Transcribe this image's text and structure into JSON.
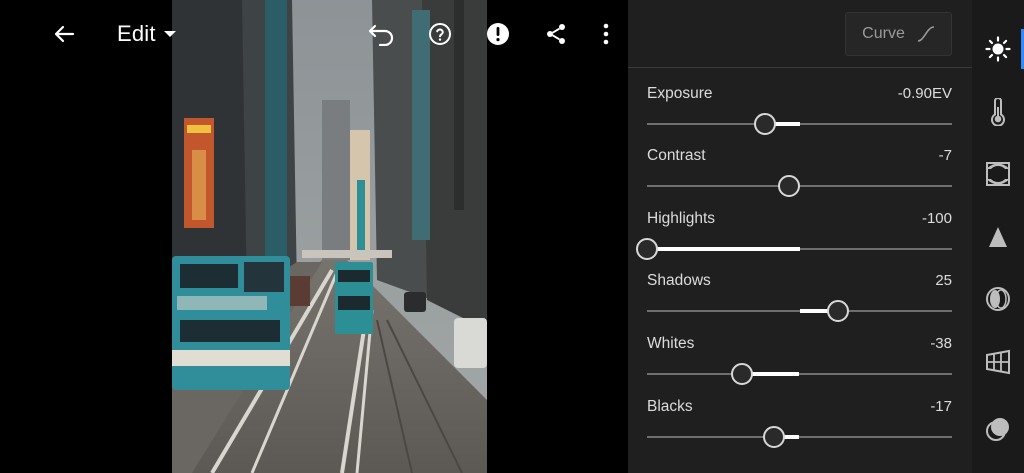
{
  "header": {
    "edit_label": "Edit"
  },
  "panel": {
    "curve_label": "Curve",
    "sliders": [
      {
        "id": "exposure",
        "label": "Exposure",
        "value_text": "-0.90EV",
        "value": -0.9,
        "min": -4,
        "max": 4
      },
      {
        "id": "contrast",
        "label": "Contrast",
        "value_text": "-7",
        "value": -7,
        "min": -100,
        "max": 100
      },
      {
        "id": "highlights",
        "label": "Highlights",
        "value_text": "-100",
        "value": -100,
        "min": -100,
        "max": 100
      },
      {
        "id": "shadows",
        "label": "Shadows",
        "value_text": "25",
        "value": 25,
        "min": -100,
        "max": 100
      },
      {
        "id": "whites",
        "label": "Whites",
        "value_text": "-38",
        "value": -38,
        "min": -100,
        "max": 100
      },
      {
        "id": "blacks",
        "label": "Blacks",
        "value_text": "-17",
        "value": -17,
        "min": -100,
        "max": 100
      }
    ]
  },
  "rail": {
    "items": [
      {
        "icon": "light-icon",
        "active": true
      },
      {
        "icon": "color-temperature-icon",
        "active": false
      },
      {
        "icon": "effects-vignette-icon",
        "active": false
      },
      {
        "icon": "detail-icon",
        "active": false
      },
      {
        "icon": "optics-icon",
        "active": false
      },
      {
        "icon": "geometry-icon",
        "active": false
      },
      {
        "icon": "presets-icon",
        "active": false
      }
    ]
  },
  "colors": {
    "panel_bg": "#1f1f1f",
    "rail_bg": "#1a1a1a",
    "accent": "#2f8cff",
    "slider_fill": "#ffffff",
    "track": "#6e6e6e"
  }
}
